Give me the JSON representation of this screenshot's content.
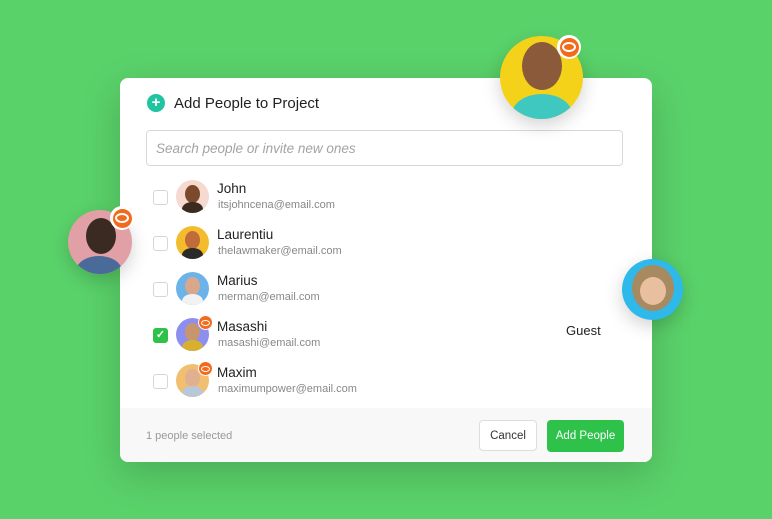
{
  "dialog": {
    "title": "Add People to Project",
    "add_icon": "plus-circle-icon",
    "search": {
      "placeholder": "Search people or invite new ones",
      "value": ""
    }
  },
  "people": [
    {
      "name": "John",
      "email": "itsjohncena@email.com",
      "checked": false,
      "viewer_badge": false,
      "role": "",
      "avatar_bg": "#f6d9cf"
    },
    {
      "name": "Laurentiu",
      "email": "thelawmaker@email.com",
      "checked": false,
      "viewer_badge": false,
      "role": "",
      "avatar_bg": "#f4bc2c"
    },
    {
      "name": "Marius",
      "email": "merman@email.com",
      "checked": false,
      "viewer_badge": false,
      "role": "",
      "avatar_bg": "#6bb3e8"
    },
    {
      "name": "Masashi",
      "email": "masashi@email.com",
      "checked": true,
      "viewer_badge": true,
      "role": "Guest",
      "avatar_bg": "#8c8ef0"
    },
    {
      "name": "Maxim",
      "email": "maximumpower@email.com",
      "checked": false,
      "viewer_badge": true,
      "role": "",
      "avatar_bg": "#f0c070"
    }
  ],
  "footer": {
    "selected_count": "1 people selected",
    "cancel_label": "Cancel",
    "add_label": "Add People"
  },
  "floating_avatars": [
    {
      "name": "top-avatar",
      "bg": "#f5d21a",
      "viewer_badge": true
    },
    {
      "name": "left-avatar",
      "bg": "#e0a0a6",
      "viewer_badge": true
    },
    {
      "name": "right-avatar",
      "bg": "#2fb8ea",
      "viewer_badge": false
    }
  ],
  "colors": {
    "background": "#5ad26a",
    "accent_green": "#2ec24a",
    "plus_teal": "#21c4a0",
    "badge_orange": "#f26b1d"
  }
}
